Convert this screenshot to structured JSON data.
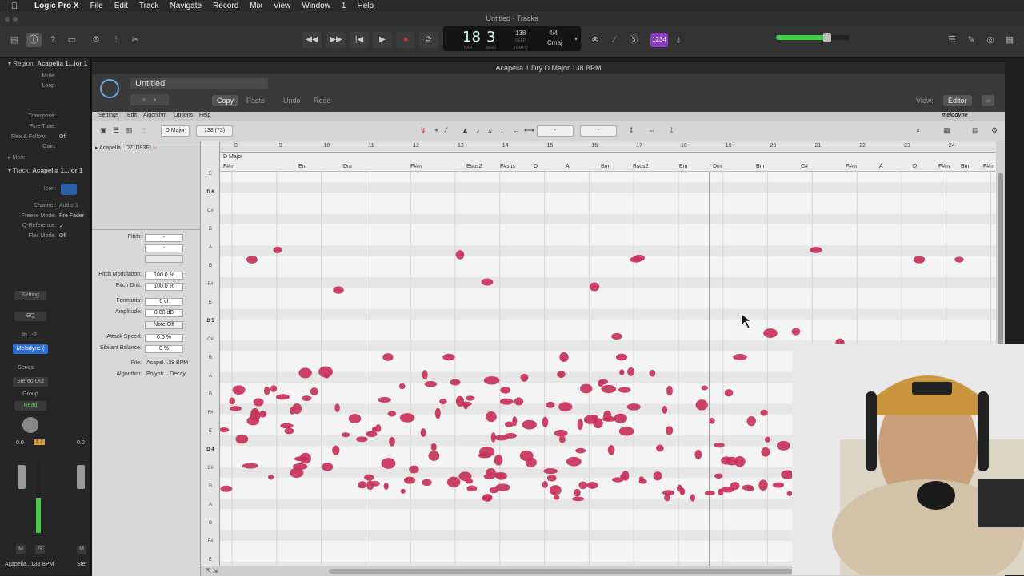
{
  "menubar": {
    "app_name": "Logic Pro X",
    "items": [
      "File",
      "Edit",
      "Track",
      "Navigate",
      "Record",
      "Mix",
      "View",
      "Window",
      "1",
      "Help"
    ]
  },
  "window_title": "Untitled - Tracks",
  "lcd": {
    "bar": "18",
    "beat": "3",
    "tempo": "138",
    "keep_label": "KEEP",
    "signature": "4/4",
    "key": "Cmaj",
    "bar_label": "BAR",
    "beat_label": "BEAT",
    "tempo_label": "TEMPO"
  },
  "volume_level": 0.7,
  "inspector": {
    "region_label": "Region:",
    "region_name": "Acapella 1...jor 1",
    "mute_label": "Mute:",
    "loop_label": "Loop:",
    "transpose_label": "Transpose:",
    "fine_tune_label": "Fine Tune:",
    "flex_follow_label": "Flex & Follow:",
    "flex_follow_value": "Off",
    "gain_label": "Gain:",
    "more_label": "More",
    "track_label": "Track:",
    "track_name": "Acapella 1...jor 1",
    "icon_label": "Icon:",
    "channel_label": "Channel:",
    "channel_value": "Audio 1",
    "freeze_label": "Freeze Mode:",
    "freeze_value": "Pre Fader",
    "qref_label": "Q-Reference:",
    "qref_value": "✓",
    "flex_mode_label": "Flex Mode:",
    "flex_mode_value": "Off",
    "setting_label": "Setting",
    "eq_label": "EQ",
    "input_label": "In 1-2",
    "plugin_label": "Melodyne (",
    "sends_label": "Sends",
    "output_label": "Stereo Out",
    "group_label": "Group",
    "automation_label": "Read",
    "vol_a": "0.0",
    "pan_a": "1.7",
    "vol_b": "0.0",
    "m_label": "M",
    "s_label": "S",
    "footer_name": "Acapella...138 BPM",
    "footer_name2": "Ster"
  },
  "melodyne": {
    "title": "Acapella 1 Dry D Major 138 BPM",
    "preset": "Untitled",
    "copy": "Copy",
    "paste": "Paste",
    "undo": "Undo",
    "redo": "Redo",
    "view_label": "View:",
    "view_value": "Editor",
    "brand": "melodyne",
    "menus": [
      "Settings",
      "Edit",
      "Algorithm",
      "Options",
      "Help"
    ],
    "key_box": "D Major",
    "tempo_box": "138 (73)",
    "track_name": "Acapella...D71D93F]",
    "scale_name": "D Major",
    "params": {
      "pitch_label": "Pitch:",
      "pitch_value": "-",
      "pitch_value2": "-",
      "pitch_mod_label": "Pitch Modulation:",
      "pitch_mod_value": "100.0 %",
      "pitch_drift_label": "Pitch Drift:",
      "pitch_drift_value": "100.0 %",
      "formants_label": "Formants:",
      "formants_value": "0 ct",
      "amplitude_label": "Amplitude:",
      "amplitude_value": "0.00 dB",
      "note_off": "Note Off",
      "attack_label": "Attack Speed:",
      "attack_value": "0.0 %",
      "sibilant_label": "Sibilant Balance:",
      "sibilant_value": "0 %",
      "file_label": "File:",
      "file_value": "Acapel...38 BPM",
      "algorithm_label": "Algorithm:",
      "algorithm_value": "Polyph... Decay"
    },
    "bars": [
      "8",
      "9",
      "10",
      "11",
      "12",
      "13",
      "14",
      "15",
      "16",
      "17",
      "18",
      "19",
      "20",
      "21",
      "22",
      "23",
      "24"
    ],
    "chords": [
      "F#m",
      "Em",
      "Dm",
      "F#m",
      "Esus2",
      "F#sus",
      "D",
      "A",
      "Bm",
      "Bsus2",
      "Em",
      "Dm",
      "Bm",
      "C#",
      "F#m",
      "A",
      "D",
      "F#m",
      "Bm",
      "F#m"
    ],
    "keys": [
      "E",
      "D 6",
      "C#",
      "B",
      "A",
      "G",
      "F#",
      "E",
      "D 5",
      "C#",
      "B",
      "A",
      "G",
      "F#",
      "E",
      "D 4",
      "C#",
      "B",
      "A",
      "G",
      "F#",
      "E"
    ]
  },
  "colors": {
    "blob": "#c8325a",
    "accent_green": "#44cc44",
    "plugin_blue": "#2e6fd6"
  }
}
